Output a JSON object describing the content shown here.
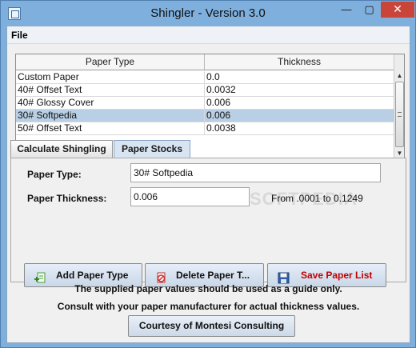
{
  "window": {
    "title": "Shingler - Version 3.0",
    "minimize": "—",
    "maximize": "▢",
    "close": "✕"
  },
  "menu": {
    "file": "File"
  },
  "table": {
    "columns": [
      "Paper Type",
      "Thickness"
    ],
    "rows": [
      {
        "type": "Custom Paper",
        "thickness": "0.0",
        "selected": false
      },
      {
        "type": "40# Offset Text",
        "thickness": "0.0032",
        "selected": false
      },
      {
        "type": "40# Glossy Cover",
        "thickness": "0.006",
        "selected": false
      },
      {
        "type": "30# Softpedia",
        "thickness": "0.006",
        "selected": true
      },
      {
        "type": "50# Offset Text",
        "thickness": "0.0038",
        "selected": false
      }
    ],
    "scroll_up": "▲",
    "scroll_down": "▼"
  },
  "tabs": [
    {
      "label": "Calculate Shingling",
      "active": false
    },
    {
      "label": "Paper Stocks",
      "active": true
    }
  ],
  "form": {
    "paper_type_label": "Paper Type:",
    "paper_type_value": "30# Softpedia",
    "thickness_label": "Paper Thickness:",
    "thickness_value": "0.006",
    "range_hint": "From .0001 to 0.1249",
    "watermark": "SOFTPEDIA"
  },
  "buttons": {
    "add": "Add Paper Type",
    "delete": "Delete Paper T...",
    "save": "Save Paper List",
    "courtesy": "Courtesy of Montesi Consulting"
  },
  "notes": {
    "line1": "The supplied paper values should be used as a guide only.",
    "line2": "Consult with your paper manufacturer for actual thickness values."
  },
  "colors": {
    "title_bar": "#7fb0dd",
    "close_button": "#c9453a",
    "selected_row": "#b8cfe5",
    "save_label": "#c00000"
  },
  "icons": {
    "app": "app-window-icon",
    "add": "add-document-icon",
    "delete": "delete-document-icon",
    "save": "floppy-disk-icon"
  }
}
